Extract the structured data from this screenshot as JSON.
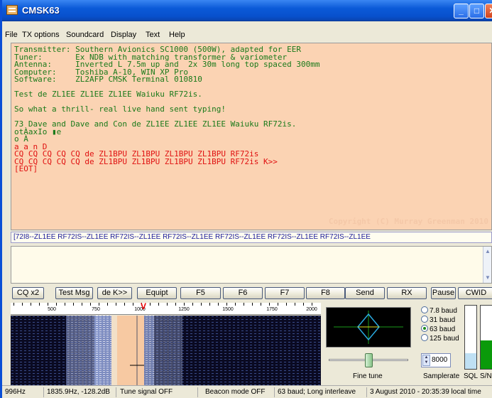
{
  "window": {
    "title": "CMSK63"
  },
  "menu": [
    "File",
    "TX options",
    "Soundcard",
    "Display",
    "Text",
    "Help"
  ],
  "rx": {
    "info_lines": [
      "Transmitter: Southern Avionics SC1000 (500W), adapted for EER",
      "Tuner:       Ex NDB with matching transformer & variometer",
      "Antenna:     Inverted L 7.5m up and  2x 30m long top spaced 300mm",
      "Computer:    Toshiba A-10, WIN XP Pro",
      "Software:    ZL2AFP CMSK Terminal 010810"
    ],
    "line_test": "Test de ZL1EE ZL1EE ZL1EE Waiuku RF72is.",
    "line_thrill": "So what a thrill- real live hand sent typing!",
    "line_73": "73 Dave and Dave and Con de ZL1EE ZL1EE ZL1EE Waiuku RF72is.",
    "garble": [
      "otÀaxIo ▮e",
      "o À"
    ],
    "red_lines": [
      "a a n D",
      "CQ CQ CQ CQ CQ de ZL1BPU ZL1BPU ZL1BPU ZL1BPU RF72is",
      "CQ CQ CQ CQ CQ de ZL1BPU ZL1BPU ZL1BPU ZL1BPU RF72is K>>",
      "[EOT]"
    ],
    "copyright": "Copyright (C) Murray Greenman 2010"
  },
  "strip": "[72I8--ZL1EE RF72IS--ZL1EE RF72IS--ZL1EE RF72IS--ZL1EE RF72IS--ZL1EE RF72IS--ZL1EE RF72IS--ZL1EE",
  "buttons": {
    "cq": "CQ x2",
    "testmsg": "Test Msg",
    "dek": "de K>>",
    "equipt": "Equipt",
    "f5": "F5",
    "f6": "F6",
    "f7": "F7",
    "f8": "F8",
    "send": "Send",
    "rx": "RX",
    "pause": "Pause",
    "cwid": "CWID"
  },
  "ruler": {
    "labels": [
      "500",
      "750",
      "1000",
      "1250",
      "1500",
      "1750",
      "2000"
    ]
  },
  "baud": {
    "o1": "7.8 baud",
    "o2": "31 baud",
    "o3": "63 baud",
    "o4": "125 baud",
    "selected": "63 baud"
  },
  "samplerate_value": "8000",
  "labels": {
    "finetune": "Fine tune",
    "samplerate": "Samplerate",
    "sql": "SQL",
    "sn": "S/N"
  },
  "levels": {
    "fine_tune": 0.5,
    "sql": 0.25,
    "sn": 0.45
  },
  "status": {
    "freq": "996Hz",
    "peak": "1835.9Hz, -128.2dB",
    "tune": "Tune signal OFF",
    "beacon": "Beacon mode OFF",
    "mode": "63 baud; Long interleave",
    "time": "3 August 2010 - 20:35:39 local time"
  },
  "colors": {
    "rx_bg": "#fbd3b3",
    "green_text": "#1a7a1a",
    "red_text": "#e01010",
    "signal_fill": "#0a9a0a",
    "sql_fill": "#bfe0f4"
  }
}
